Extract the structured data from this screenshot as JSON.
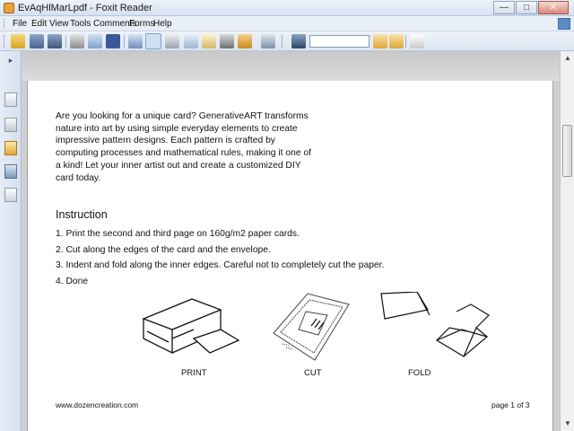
{
  "window": {
    "title": "EvAqHlMarLpdf - Foxit Reader"
  },
  "window_controls": {
    "minimize": "—",
    "maximize": "□",
    "close": "✕"
  },
  "menu": {
    "items": [
      "File",
      "Edit",
      "View",
      "Tools",
      "Comments",
      "Forms",
      "Help"
    ]
  },
  "toolbar": {
    "icons": [
      "open-icon",
      "save-icon",
      "save-as-icon",
      "print-icon",
      "email-icon",
      "facebook-icon",
      "typewriter-icon",
      "hand-tool-icon",
      "snapshot-icon",
      "select-icon",
      "text-select-icon",
      "camera-icon",
      "stamp-icon",
      "scissors-icon",
      "binoculars-icon",
      "find-prev-icon",
      "find-next-icon",
      "properties-icon"
    ],
    "find_value": ""
  },
  "sidebar": {
    "toggle_glyph": "▸",
    "icons": [
      "pages-icon",
      "bookmark-icon",
      "comment-icon",
      "attachment-icon",
      "signature-icon"
    ]
  },
  "document": {
    "intro": "Are you looking for a unique card? GenerativeART transforms nature into art by using simple everyday elements to create impressive pattern designs. Each pattern is crafted by computing processes and mathematical rules, making it one of a kind! Let your inner artist out and create a customized DIY card today.",
    "heading": "Instruction",
    "steps": [
      "1. Print the second and third page on 160g/m2 paper cards.",
      "2. Cut along the edges of the card and the envelope.",
      "3. Indent and fold along the inner edges. Careful not to completely cut the paper.",
      "4. Done"
    ],
    "captions": {
      "print": "PRINT",
      "cut": "CUT",
      "fold": "FOLD"
    },
    "footer_url": "www.dozencreation.com",
    "footer_page": "page 1 of 3"
  },
  "scrollbar": {
    "up": "▲",
    "down": "▼"
  }
}
